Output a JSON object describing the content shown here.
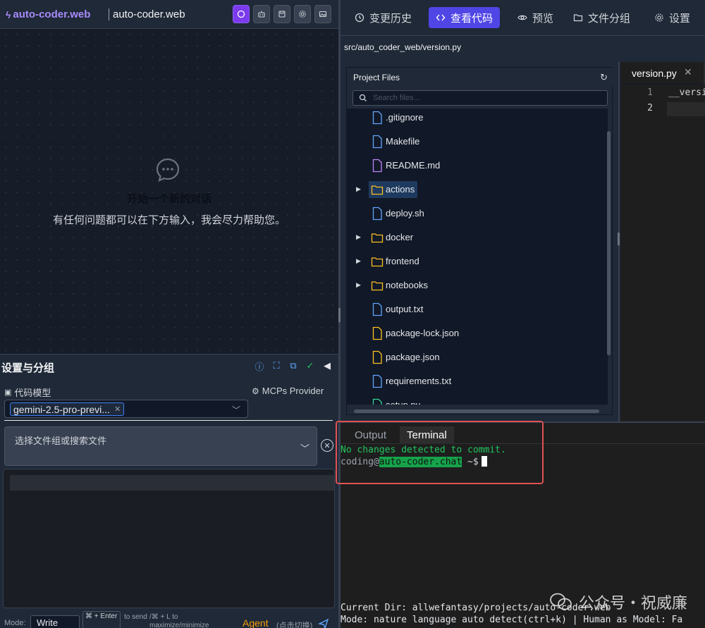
{
  "header": {
    "brand": "auto-coder.web",
    "project_name": "auto-coder.web"
  },
  "chat": {
    "empty_title": "开始一个新的对话",
    "empty_subtitle": "有任何问题都可以在下方输入，我会尽力帮助您。"
  },
  "settings": {
    "title": "设置与分组",
    "code_model_label": "代码模型",
    "mcp_label": "MCPs Provider",
    "model_tag": "gemini-2.5-pro-previ...",
    "file_select_placeholder": "选择文件组或搜索文件"
  },
  "bottom_bar": {
    "mode_label": "Mode:",
    "mode_value": "Write",
    "kbd_hint": "⌘ + Enter",
    "to": "to send",
    "maximize_hint": "/⌘ + L to maximize/minimize",
    "agent": "Agent",
    "switch_hint": "(点击切换)"
  },
  "right_tabs": [
    {
      "label": "变更历史",
      "icon": "history-icon"
    },
    {
      "label": "查看代码",
      "icon": "code-icon"
    },
    {
      "label": "预览",
      "icon": "eye-icon"
    },
    {
      "label": "文件分组",
      "icon": "folder-icon"
    },
    {
      "label": "设置",
      "icon": "gear-icon"
    }
  ],
  "breadcrumb": "src/auto_coder_web/version.py",
  "tree": {
    "title": "Project Files",
    "search_placeholder": "Search files...",
    "items": [
      {
        "name": ".gitignore",
        "type": "file",
        "color": "#60a5fa"
      },
      {
        "name": "Makefile",
        "type": "file",
        "color": "#60a5fa"
      },
      {
        "name": "README.md",
        "type": "file",
        "color": "#c084fc"
      },
      {
        "name": "actions",
        "type": "folder",
        "selected": true
      },
      {
        "name": "deploy.sh",
        "type": "file",
        "color": "#60a5fa"
      },
      {
        "name": "docker",
        "type": "folder"
      },
      {
        "name": "frontend",
        "type": "folder"
      },
      {
        "name": "notebooks",
        "type": "folder"
      },
      {
        "name": "output.txt",
        "type": "file",
        "color": "#60a5fa"
      },
      {
        "name": "package-lock.json",
        "type": "file",
        "color": "#fbbf24"
      },
      {
        "name": "package.json",
        "type": "file",
        "color": "#fbbf24"
      },
      {
        "name": "requirements.txt",
        "type": "file",
        "color": "#60a5fa"
      },
      {
        "name": "setup.py",
        "type": "file",
        "color": "#34d399"
      }
    ]
  },
  "code_editor": {
    "tab": "version.py",
    "lines": [
      "__version__",
      ""
    ]
  },
  "terminal": {
    "tabs": [
      "Output",
      "Terminal"
    ],
    "line1": "No changes detected to commit.",
    "prompt_user": "coding@",
    "prompt_host": "auto-coder.chat",
    "prompt_tail": " ~$",
    "status_dir": "Current Dir: allwefantasy/projects/auto-coder.web",
    "status_mode": "Mode: nature language auto detect(ctrl+k) | Human as Model: Fa"
  },
  "watermark": "公众号・祝威廉",
  "colors": {
    "accent": "#4f46e5",
    "brand": "#a78bfa",
    "terminal_green": "#22c55e",
    "highlight_box": "#e05151"
  }
}
